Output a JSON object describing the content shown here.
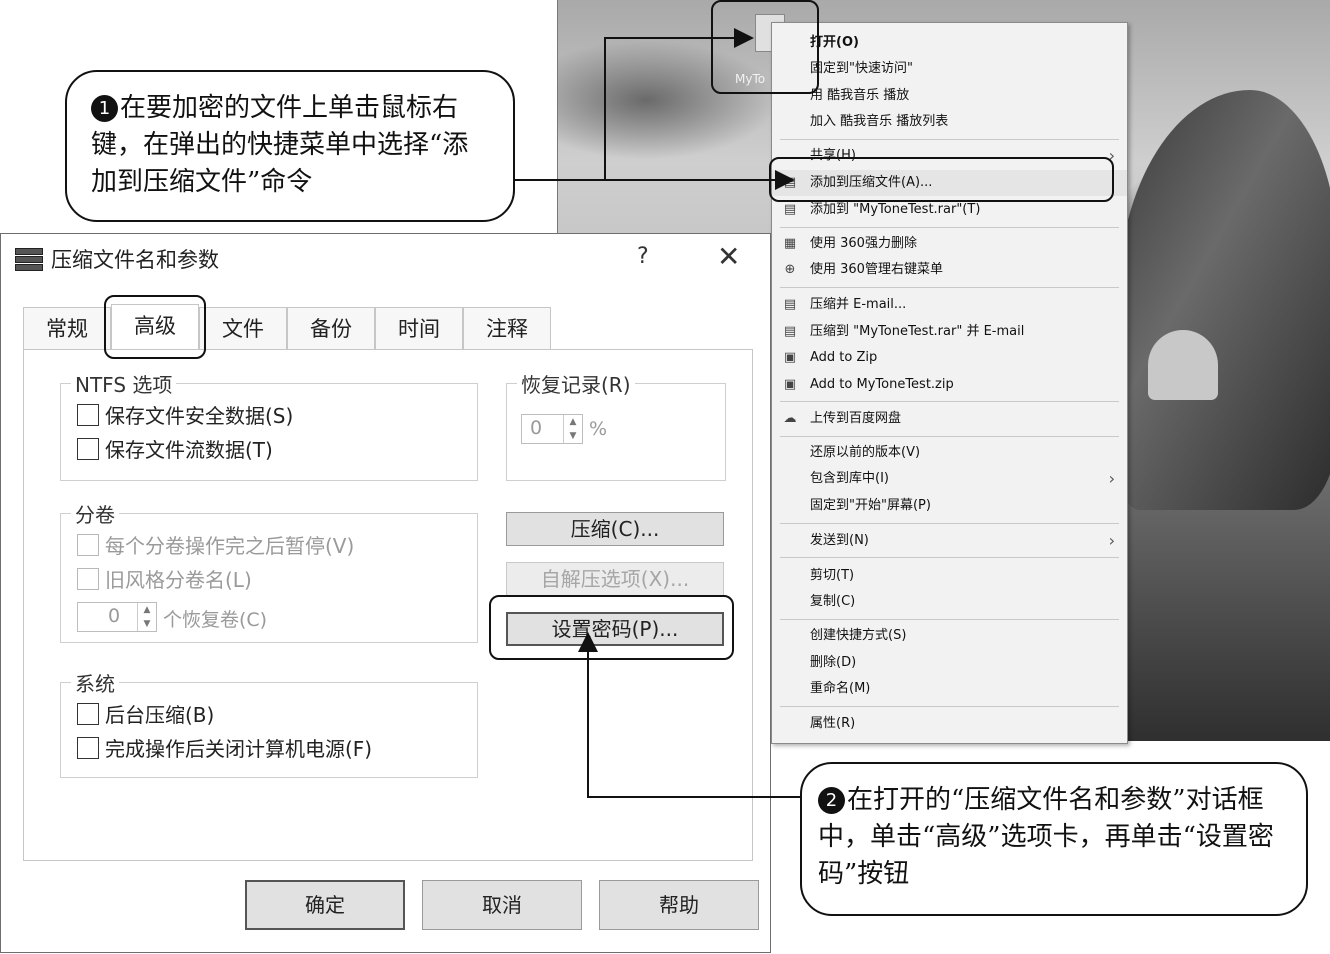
{
  "desktop": {
    "file_icon_label": "MyTo"
  },
  "context_menu": {
    "items": [
      {
        "label": "打开(O)",
        "icon": ""
      },
      {
        "label": "固定到\"快速访问\"",
        "icon": ""
      },
      {
        "label": "用 酷我音乐 播放",
        "icon": ""
      },
      {
        "label": "加入 酷我音乐 播放列表",
        "icon": ""
      },
      {
        "label": "共享(H)",
        "icon": "",
        "submenu": true
      },
      {
        "label": "添加到压缩文件(A)...",
        "icon": "winrar-icon"
      },
      {
        "label": "添加到 \"MyToneTest.rar\"(T)",
        "icon": "winrar-icon"
      },
      {
        "label": "使用 360强力删除",
        "icon": "360-delete-icon"
      },
      {
        "label": "使用 360管理右键菜单",
        "icon": "360-manage-icon"
      },
      {
        "label": "压缩并 E-mail...",
        "icon": "winrar-icon"
      },
      {
        "label": "压缩到 \"MyToneTest.rar\" 并 E-mail",
        "icon": "winrar-icon"
      },
      {
        "label": "Add to Zip",
        "icon": "zip-icon"
      },
      {
        "label": "Add to MyToneTest.zip",
        "icon": "zip-icon"
      },
      {
        "label": "上传到百度网盘",
        "icon": "baidu-cloud-icon"
      },
      {
        "label": "还原以前的版本(V)",
        "icon": ""
      },
      {
        "label": "包含到库中(I)",
        "icon": "",
        "submenu": true
      },
      {
        "label": "固定到\"开始\"屏幕(P)",
        "icon": ""
      },
      {
        "label": "发送到(N)",
        "icon": "",
        "submenu": true
      },
      {
        "label": "剪切(T)",
        "icon": ""
      },
      {
        "label": "复制(C)",
        "icon": ""
      },
      {
        "label": "创建快捷方式(S)",
        "icon": ""
      },
      {
        "label": "删除(D)",
        "icon": ""
      },
      {
        "label": "重命名(M)",
        "icon": ""
      },
      {
        "label": "属性(R)",
        "icon": ""
      }
    ]
  },
  "dialog": {
    "title": "压缩文件名和参数",
    "help_label": "?",
    "close_label": "✕",
    "tabs": [
      "常规",
      "高级",
      "文件",
      "备份",
      "时间",
      "注释"
    ],
    "active_tab": "高级",
    "ntfs": {
      "label": "NTFS 选项",
      "save_security": "保存文件安全数据(S)",
      "save_streams": "保存文件流数据(T)"
    },
    "recovery": {
      "label": "恢复记录(R)",
      "value": "0",
      "unit": "%"
    },
    "volumes": {
      "label": "分卷",
      "pause": "每个分卷操作完之后暂停(V)",
      "old_style": "旧风格分卷名(L)",
      "recovery_volumes_value": "0",
      "recovery_volumes_label": "个恢复卷(C)"
    },
    "buttons": {
      "compression": "压缩(C)...",
      "sfx": "自解压选项(X)...",
      "set_password": "设置密码(P)..."
    },
    "system": {
      "label": "系统",
      "background": "后台压缩(B)",
      "shutdown": "完成操作后关闭计算机电源(F)"
    },
    "footer": {
      "ok": "确定",
      "cancel": "取消",
      "help": "帮助"
    }
  },
  "callouts": {
    "step1_number": "❶",
    "step1_text": "在要加密的文件上单击鼠标右键，在弹出的快捷菜单中选择“添加到压缩文件”命令",
    "step2_number": "❷",
    "step2_text": "在打开的“压缩文件名和参数”对话框中，单击“高级”选项卡，再单击“设置密码”按钮"
  }
}
